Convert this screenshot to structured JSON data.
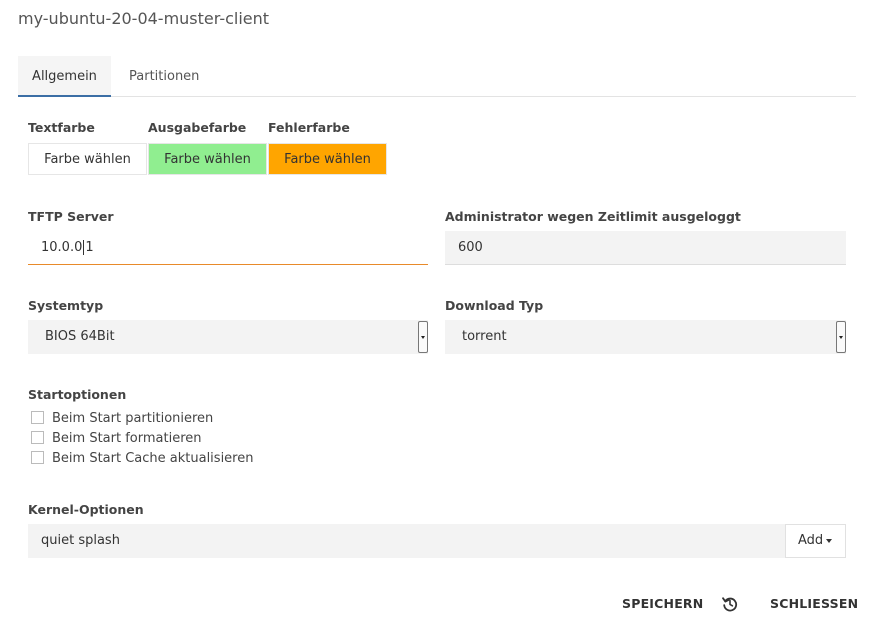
{
  "dialog": {
    "title": "my-ubuntu-20-04-muster-client"
  },
  "tabs": [
    {
      "label": "Allgemein"
    },
    {
      "label": "Partitionen"
    }
  ],
  "colors": {
    "text_color": {
      "label": "Textfarbe",
      "button": "Farbe wählen",
      "value": "#ffffff"
    },
    "output_color": {
      "label": "Ausgabefarbe",
      "button": "Farbe wählen",
      "value": "#90ee90"
    },
    "error_color": {
      "label": "Fehlerfarbe",
      "button": "Farbe wählen",
      "value": "#ffa500"
    }
  },
  "tftp": {
    "label": "TFTP Server",
    "value_before_cursor": "10.0.0",
    "value_after_cursor": "1"
  },
  "admin_timeout": {
    "label": "Administrator wegen Zeitlimit ausgeloggt",
    "value": "600"
  },
  "system_type": {
    "label": "Systemtyp",
    "selected": "BIOS 64Bit"
  },
  "download_type": {
    "label": "Download Typ",
    "selected": "torrent"
  },
  "start_options": {
    "label": "Startoptionen",
    "items": [
      {
        "label": "Beim Start partitionieren",
        "checked": false
      },
      {
        "label": "Beim Start formatieren",
        "checked": false
      },
      {
        "label": "Beim Start Cache aktualisieren",
        "checked": false
      }
    ]
  },
  "kernel_options": {
    "label": "Kernel-Optionen",
    "value": "quiet splash",
    "add_label": "Add"
  },
  "footer": {
    "save_label": "SPEICHERN",
    "close_label": "SCHLIESSEN",
    "reset_icon": "history-icon"
  },
  "accent": {
    "tab_underline": "#3b6ea5",
    "focus_underline": "#e88a2a"
  }
}
